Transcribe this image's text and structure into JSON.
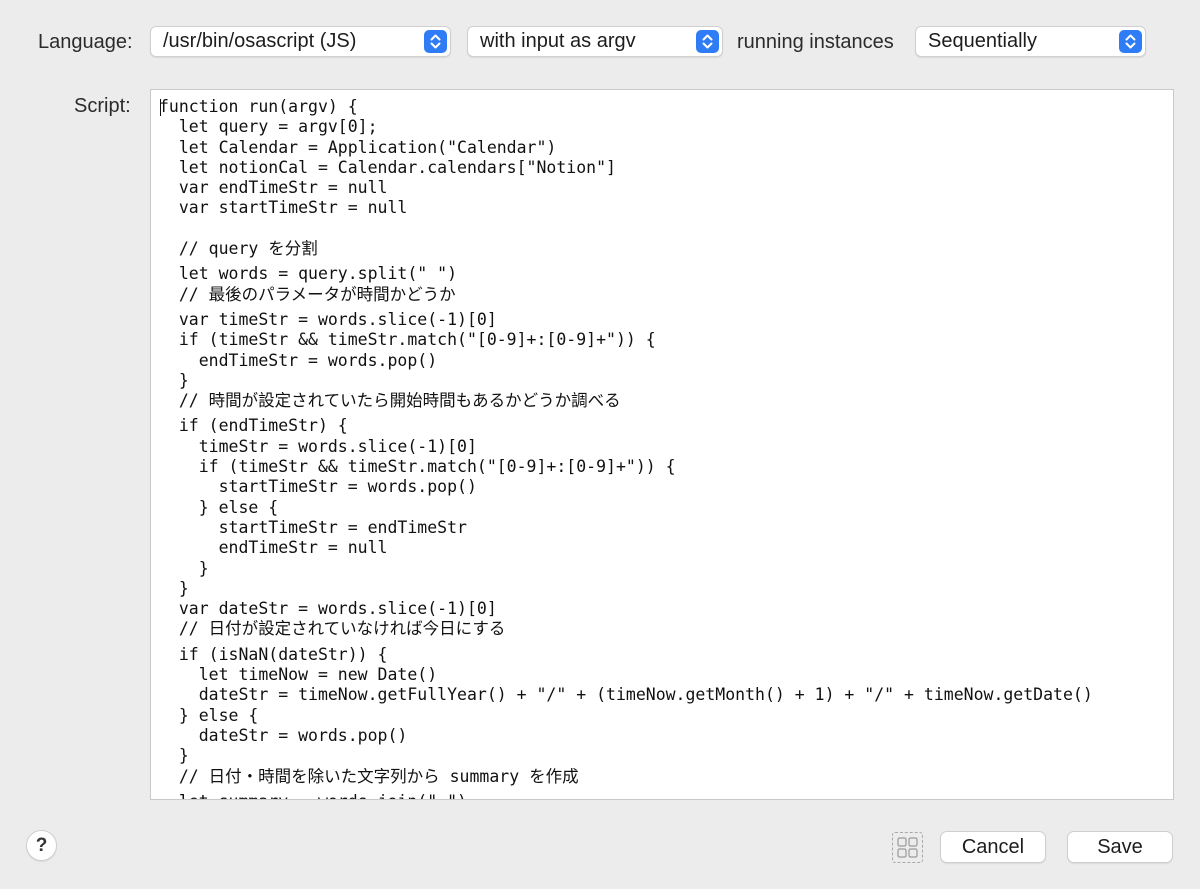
{
  "toolbar": {
    "language_label": "Language:",
    "language_value": "/usr/bin/osascript (JS)",
    "input_mode_value": "with input as argv",
    "instances_label": "running instances",
    "instances_value": "Sequentially"
  },
  "editor": {
    "script_label": "Script:",
    "lines": [
      "function run(argv) {",
      "  let query = argv[0];",
      "  let Calendar = Application(\"Calendar\")",
      "  let notionCal = Calendar.calendars[\"Notion\"]",
      "  var endTimeStr = null",
      "  var startTimeStr = null",
      "",
      "  // query を分割",
      "  let words = query.split(\" \")",
      "  // 最後のパラメータが時間かどうか",
      "  var timeStr = words.slice(-1)[0]",
      "  if (timeStr && timeStr.match(\"[0-9]+:[0-9]+\")) {",
      "    endTimeStr = words.pop()",
      "  }",
      "  // 時間が設定されていたら開始時間もあるかどうか調べる",
      "  if (endTimeStr) {",
      "    timeStr = words.slice(-1)[0]",
      "    if (timeStr && timeStr.match(\"[0-9]+:[0-9]+\")) {",
      "      startTimeStr = words.pop()",
      "    } else {",
      "      startTimeStr = endTimeStr",
      "      endTimeStr = null",
      "    }",
      "  }",
      "  var dateStr = words.slice(-1)[0]",
      "  // 日付が設定されていなければ今日にする",
      "  if (isNaN(dateStr)) {",
      "    let timeNow = new Date()",
      "    dateStr = timeNow.getFullYear() + \"/\" + (timeNow.getMonth() + 1) + \"/\" + timeNow.getDate()",
      "  } else {",
      "    dateStr = words.pop()",
      "  }",
      "  // 日付・時間を除いた文字列から summary を作成",
      "  let summary = words.join(\" \")"
    ]
  },
  "footer": {
    "help_label": "?",
    "cancel_label": "Cancel",
    "save_label": "Save"
  },
  "colors": {
    "accent": "#2e7cf6",
    "window_bg": "#ececec"
  }
}
